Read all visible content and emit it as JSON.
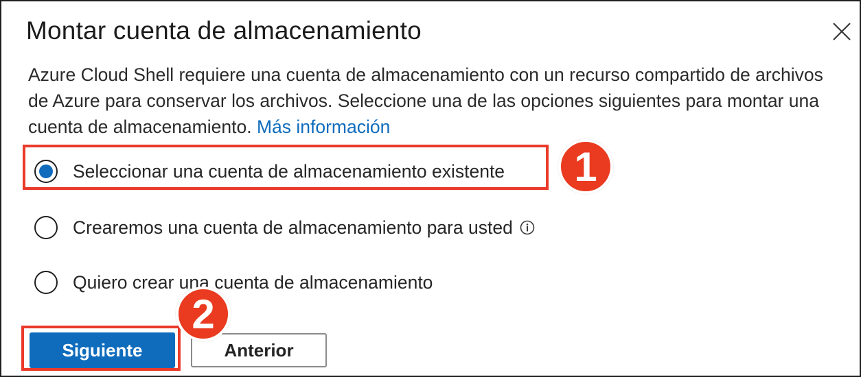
{
  "dialog": {
    "title": "Montar cuenta de almacenamiento",
    "close_icon": "close-icon",
    "description": "Azure Cloud Shell requiere una cuenta de almacenamiento con un recurso compartido de archivos de Azure para conservar los archivos. Seleccione una de las opciones siguientes para montar una cuenta de almacenamiento.",
    "learn_more_link": "Más información"
  },
  "options": [
    {
      "label": "Seleccionar una cuenta de almacenamiento existente",
      "selected": true
    },
    {
      "label": "Crearemos una cuenta de almacenamiento para usted",
      "selected": false,
      "icon": "info-icon"
    },
    {
      "label": "Quiero crear una cuenta de almacenamiento",
      "selected": false
    }
  ],
  "buttons": {
    "next_label": "Siguiente",
    "back_label": "Anterior"
  },
  "annotations": {
    "step1": "1",
    "step2": "2",
    "highlight_color": "#EA3A2A"
  },
  "colors": {
    "accent": "#0F6CBD",
    "text": "#262626"
  }
}
